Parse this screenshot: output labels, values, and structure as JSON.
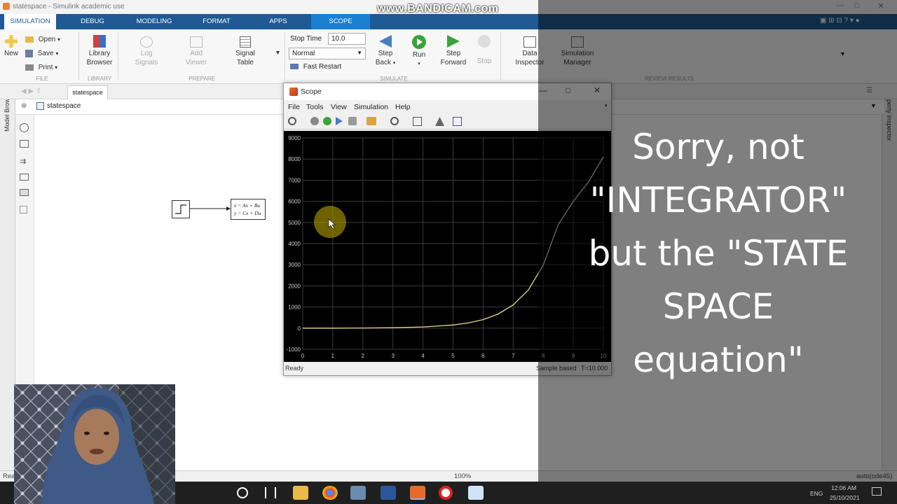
{
  "window": {
    "title": "statespace - Simulink academic use",
    "watermark": "www.BANDICAM.com"
  },
  "tabs": [
    "SIMULATION",
    "DEBUG",
    "MODELING",
    "FORMAT",
    "APPS",
    "SCOPE"
  ],
  "toolstrip": {
    "file": {
      "new": "New",
      "open": "Open",
      "save": "Save",
      "print": "Print",
      "section": "FILE"
    },
    "library": {
      "label1": "Library",
      "label2": "Browser",
      "section": "LIBRARY"
    },
    "prepare": {
      "log1": "Log",
      "log2": "Signals",
      "add1": "Add",
      "add2": "Viewer",
      "sig1": "Signal",
      "sig2": "Table",
      "section": "PREPARE"
    },
    "simulate": {
      "stop_time_label": "Stop Time",
      "stop_time_value": "10.0",
      "mode": "Normal",
      "fast_restart": "Fast Restart",
      "step_back1": "Step",
      "step_back2": "Back",
      "run": "Run",
      "step_fwd1": "Step",
      "step_fwd2": "Forward",
      "stop": "Stop",
      "section": "SIMULATE"
    },
    "review": {
      "data1": "Data",
      "data2": "Inspector",
      "sim1": "Simulation",
      "sim2": "Manager",
      "section": "REVIEW RESULTS"
    }
  },
  "editor": {
    "tab": "statespace",
    "path": "statespace",
    "model_browser": "Model Browser",
    "property_inspector": "Property Inspector",
    "block_eq1": "ẋ = Ax + Bu",
    "block_eq2": "y = Cx + Du"
  },
  "statusbar": {
    "left": "Rea",
    "zoom": "100%",
    "solver": "auto(ode45)"
  },
  "scope": {
    "title": "Scope",
    "menus": [
      "File",
      "Tools",
      "View",
      "Simulation",
      "Help"
    ],
    "status_left": "Ready",
    "sample_based": "Sample based",
    "time": "T=10.000"
  },
  "chart_data": {
    "type": "line",
    "title": "",
    "xlabel": "",
    "ylabel": "",
    "xlim": [
      0,
      10
    ],
    "ylim": [
      -1000,
      9000
    ],
    "xticks": [
      0,
      1,
      2,
      3,
      4,
      5,
      6,
      7,
      8,
      9,
      10
    ],
    "yticks": [
      -1000,
      0,
      1000,
      2000,
      3000,
      4000,
      5000,
      6000,
      7000,
      8000,
      9000
    ],
    "grid": true,
    "series": [
      {
        "color": "#e6d98a",
        "x": [
          0,
          1,
          2,
          3,
          4,
          5,
          5.5,
          6,
          6.5,
          7,
          7.5,
          8,
          8.5,
          9,
          9.5,
          10
        ],
        "y": [
          0,
          1,
          7,
          20,
          55,
          150,
          245,
          405,
          670,
          1100,
          1800,
          2980,
          4900,
          6000,
          6900,
          8100
        ]
      }
    ]
  },
  "caption": {
    "line1": "Sorry, not",
    "line2": "\"INTEGRATOR\"",
    "line3": "but the \"STATE",
    "line4": "SPACE",
    "line5": "equation\""
  },
  "tray": {
    "time": "12:06 AM",
    "date": "25/10/2021",
    "lang": "ENG"
  }
}
